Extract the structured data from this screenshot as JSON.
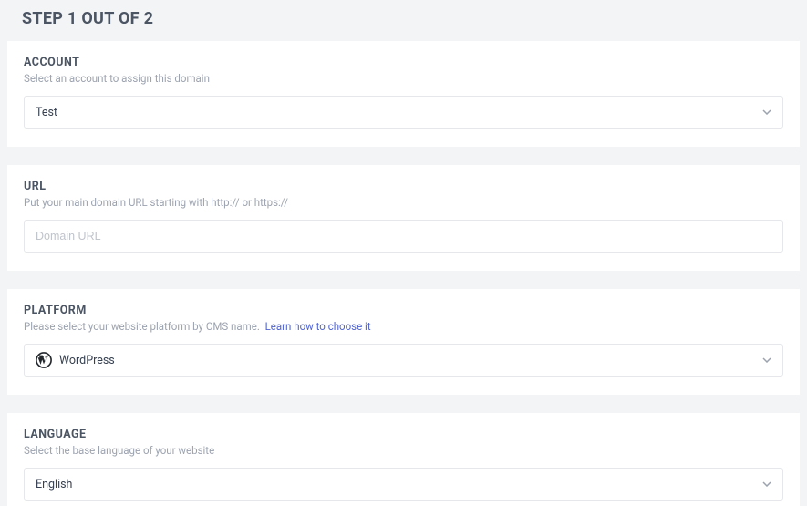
{
  "step": {
    "title": "STEP 1 OUT OF 2"
  },
  "account": {
    "label": "ACCOUNT",
    "help": "Select an account to assign this domain",
    "value": "Test"
  },
  "url": {
    "label": "URL",
    "help": "Put your main domain URL starting with http:// or https://",
    "placeholder": "Domain URL"
  },
  "platform": {
    "label": "PLATFORM",
    "help": "Please select your website platform by CMS name.",
    "link_text": "Learn how to choose it",
    "value": "WordPress"
  },
  "language": {
    "label": "LANGUAGE",
    "help": "Select the base language of your website",
    "value": "English"
  }
}
